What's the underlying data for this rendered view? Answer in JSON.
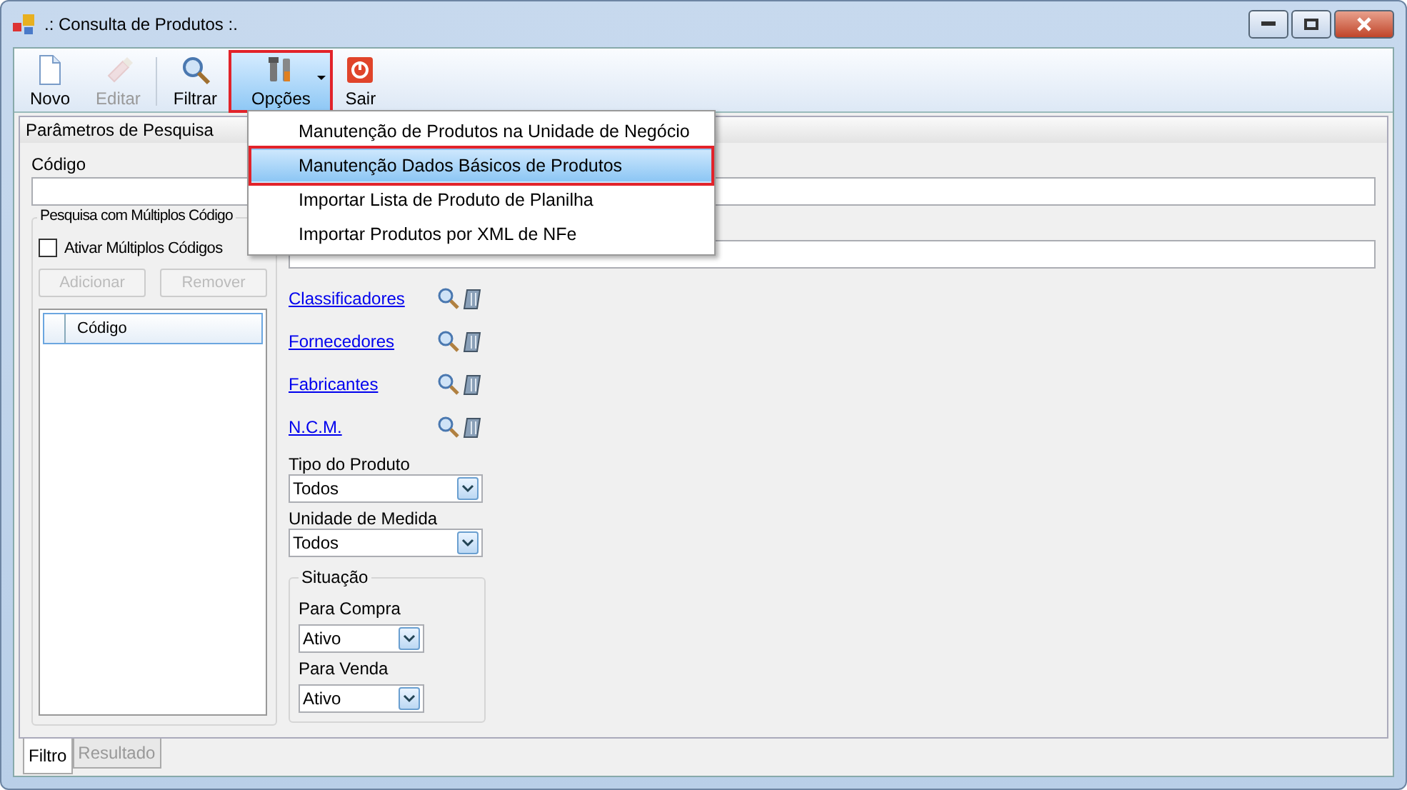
{
  "window": {
    "title": ".: Consulta de Produtos :."
  },
  "toolbar": [
    {
      "label": "Novo",
      "kind": "new",
      "disabled": false,
      "selected": false,
      "dropdown": false
    },
    {
      "label": "Editar",
      "kind": "edit",
      "disabled": true,
      "selected": false,
      "dropdown": false
    },
    {
      "label": "Filtrar",
      "kind": "filter",
      "disabled": false,
      "selected": false,
      "dropdown": false
    },
    {
      "label": "Opções",
      "kind": "tools",
      "disabled": false,
      "selected": true,
      "dropdown": true
    },
    {
      "label": "Sair",
      "kind": "exit",
      "disabled": false,
      "selected": false,
      "dropdown": false
    }
  ],
  "menu": [
    {
      "label": "Manutenção de Produtos na Unidade de Negócio",
      "selected": false
    },
    {
      "label": "Manutenção Dados Básicos de Produtos",
      "selected": true
    },
    {
      "label": "Importar Lista de Produto de Planilha",
      "selected": false
    },
    {
      "label": "Importar Produtos por XML de NFe",
      "selected": false
    }
  ],
  "panel": {
    "title": "Parâmetros de Pesquisa",
    "code_label": "Código"
  },
  "multi": {
    "title": "Pesquisa com Múltiplos Código",
    "checkbox": {
      "label": "Ativar Múltiplos Códigos",
      "checked": false
    },
    "buttons": [
      {
        "label": "Adicionar",
        "disabled": true
      },
      {
        "label": "Remover",
        "disabled": true
      }
    ],
    "columns": [
      "Código"
    ]
  },
  "lookups": [
    {
      "label": "Classificadores"
    },
    {
      "label": "Fornecedores"
    },
    {
      "label": "Fabricantes"
    },
    {
      "label": "N.C.M."
    }
  ],
  "selects": [
    {
      "label": "Tipo do Produto",
      "value": "Todos"
    },
    {
      "label": "Unidade de Medida",
      "value": "Todos"
    }
  ],
  "situacao": {
    "title": "Situação",
    "selects": [
      {
        "label": "Para Compra",
        "value": "Ativo"
      },
      {
        "label": "Para Venda",
        "value": "Ativo"
      }
    ]
  },
  "tabs": [
    {
      "label": "Filtro",
      "selected": true
    },
    {
      "label": "Resultado",
      "selected": false
    }
  ]
}
